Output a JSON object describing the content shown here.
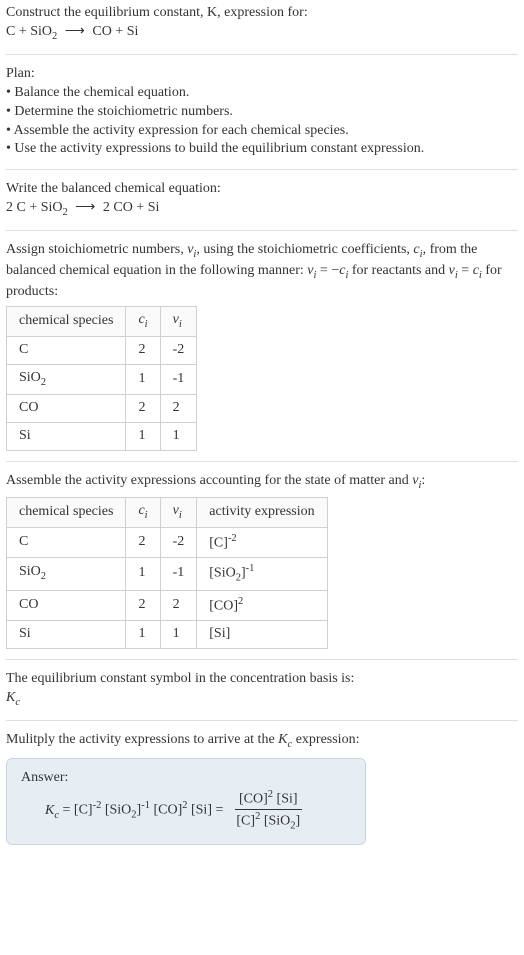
{
  "intro": {
    "line1": "Construct the equilibrium constant, K, expression for:",
    "equation": "C + SiO₂ ⟶ CO + Si"
  },
  "plan": {
    "heading": "Plan:",
    "items": [
      "• Balance the chemical equation.",
      "• Determine the stoichiometric numbers.",
      "• Assemble the activity expression for each chemical species.",
      "• Use the activity expressions to build the equilibrium constant expression."
    ]
  },
  "balanced": {
    "heading": "Write the balanced chemical equation:",
    "equation": "2 C + SiO₂ ⟶ 2 CO + Si"
  },
  "stoich": {
    "intro1": "Assign stoichiometric numbers, νᵢ, using the stoichiometric coefficients, cᵢ, from the balanced chemical equation in the following manner: νᵢ = −cᵢ for reactants and νᵢ = cᵢ for products:",
    "headers": [
      "chemical species",
      "cᵢ",
      "νᵢ"
    ],
    "rows": [
      [
        "C",
        "2",
        "-2"
      ],
      [
        "SiO₂",
        "1",
        "-1"
      ],
      [
        "CO",
        "2",
        "2"
      ],
      [
        "Si",
        "1",
        "1"
      ]
    ]
  },
  "activity": {
    "intro": "Assemble the activity expressions accounting for the state of matter and νᵢ:",
    "headers": [
      "chemical species",
      "cᵢ",
      "νᵢ",
      "activity expression"
    ],
    "rows": [
      [
        "C",
        "2",
        "-2",
        "[C]⁻²"
      ],
      [
        "SiO₂",
        "1",
        "-1",
        "[SiO₂]⁻¹"
      ],
      [
        "CO",
        "2",
        "2",
        "[CO]²"
      ],
      [
        "Si",
        "1",
        "1",
        "[Si]"
      ]
    ]
  },
  "symbol": {
    "line": "The equilibrium constant symbol in the concentration basis is:",
    "kc": "K_c"
  },
  "multiply": {
    "line": "Mulitply the activity expressions to arrive at the K_c expression:"
  },
  "answer": {
    "label": "Answer:",
    "lhs": "K_c = [C]⁻² [SiO₂]⁻¹ [CO]² [Si] =",
    "num": "[CO]² [Si]",
    "den": "[C]² [SiO₂]"
  },
  "chart_data": {
    "type": "table",
    "tables": [
      {
        "title": "Stoichiometric numbers",
        "columns": [
          "chemical species",
          "c_i",
          "nu_i"
        ],
        "rows": [
          {
            "chemical species": "C",
            "c_i": 2,
            "nu_i": -2
          },
          {
            "chemical species": "SiO2",
            "c_i": 1,
            "nu_i": -1
          },
          {
            "chemical species": "CO",
            "c_i": 2,
            "nu_i": 2
          },
          {
            "chemical species": "Si",
            "c_i": 1,
            "nu_i": 1
          }
        ]
      },
      {
        "title": "Activity expressions",
        "columns": [
          "chemical species",
          "c_i",
          "nu_i",
          "activity expression"
        ],
        "rows": [
          {
            "chemical species": "C",
            "c_i": 2,
            "nu_i": -2,
            "activity expression": "[C]^-2"
          },
          {
            "chemical species": "SiO2",
            "c_i": 1,
            "nu_i": -1,
            "activity expression": "[SiO2]^-1"
          },
          {
            "chemical species": "CO",
            "c_i": 2,
            "nu_i": 2,
            "activity expression": "[CO]^2"
          },
          {
            "chemical species": "Si",
            "c_i": 1,
            "nu_i": 1,
            "activity expression": "[Si]"
          }
        ]
      }
    ],
    "balanced_equation": "2 C + SiO2 -> 2 CO + Si",
    "Kc_expression": "[CO]^2 [Si] / ([C]^2 [SiO2])"
  }
}
